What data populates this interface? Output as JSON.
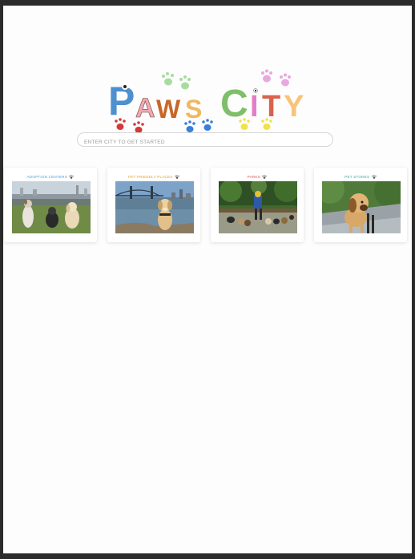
{
  "logo": {
    "text": "Paws City",
    "colors": [
      "#4e8fd0",
      "#f2a7b3",
      "#c8662a",
      "#f0b860",
      "#7fbf6a",
      "#e27dc9",
      "#d9624f",
      "#f7c47a"
    ]
  },
  "search": {
    "placeholder": "ENTER CITY TO GET STARTED",
    "value": ""
  },
  "cards": [
    {
      "title": "ADOPTION CENTERS",
      "color": "#4aa0d8",
      "image": "dogs-on-grass-photo"
    },
    {
      "title": "PET FRIENDLY PLACES",
      "color": "#e0a32a",
      "image": "dog-by-bridge-photo"
    },
    {
      "title": "PARKS",
      "color": "#e0524a",
      "image": "dog-walker-in-park-photo"
    },
    {
      "title": "PET STORES",
      "color": "#38a8a0",
      "image": "dog-on-sidewalk-photo"
    }
  ],
  "decor_paws": [
    "#d23a3a",
    "#3a7fd8",
    "#f2e24a",
    "#9fd89a",
    "#e9a7e0"
  ]
}
